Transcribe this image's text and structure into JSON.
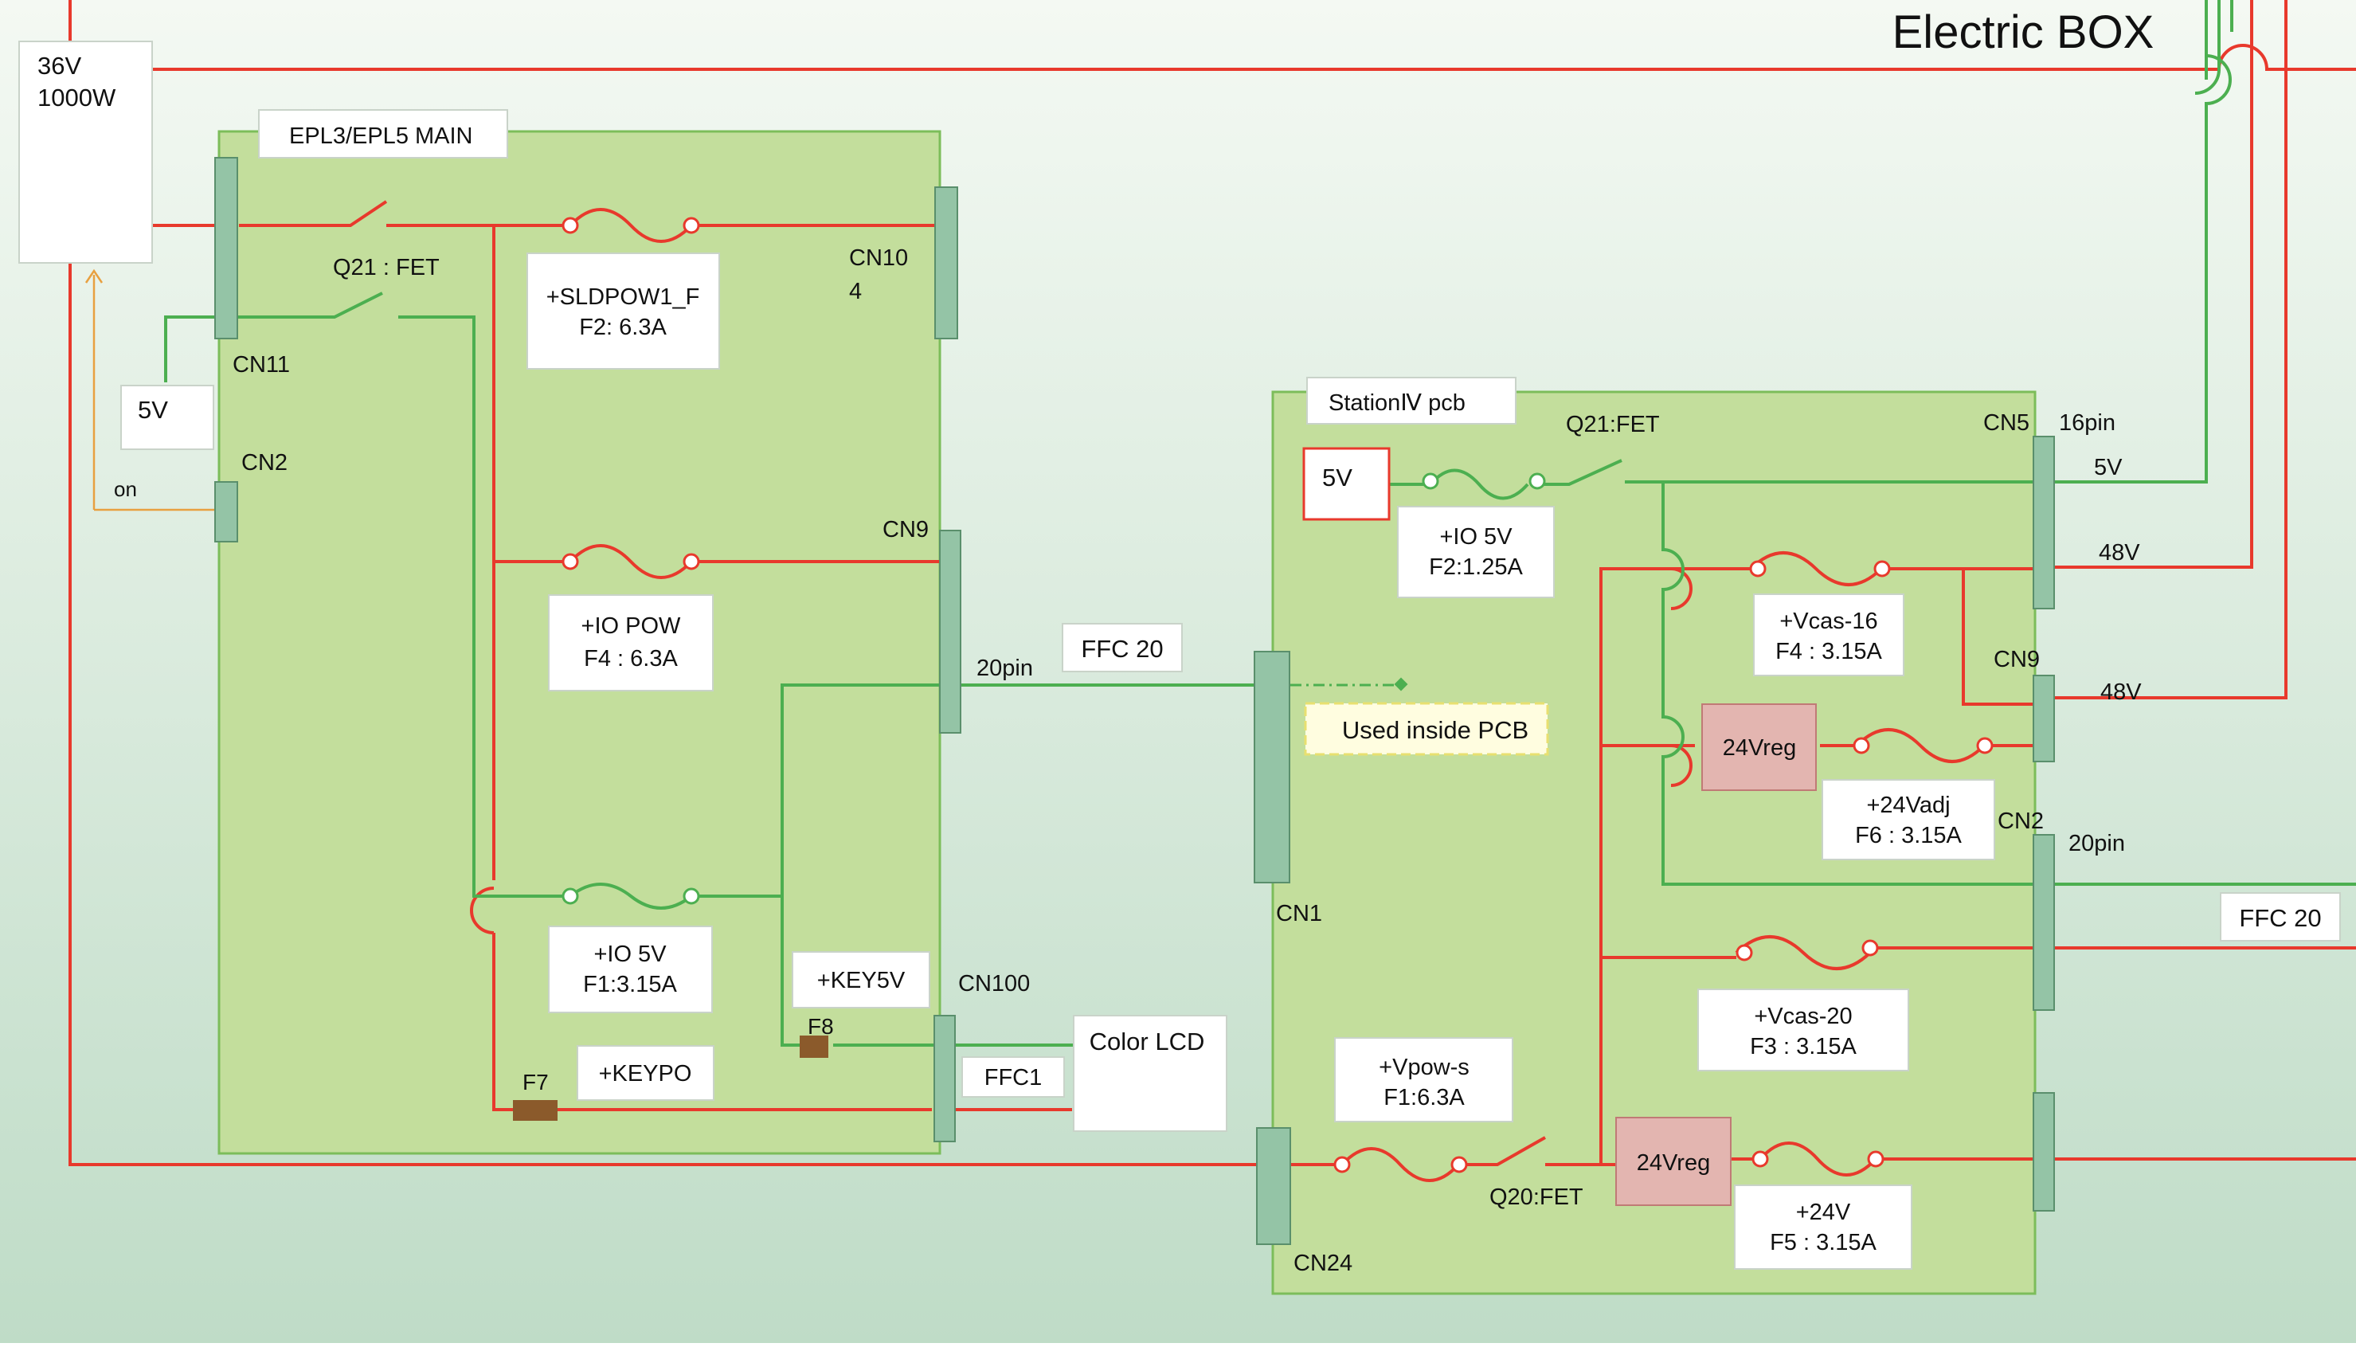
{
  "title": "Electric BOX",
  "psu": {
    "voltage": "36V",
    "power": "1000W"
  },
  "main_board": {
    "label": "EPL3/EPL5 MAIN",
    "switch_label": "Q21 : FET",
    "connectors": {
      "cn11": "CN11",
      "cn2": "CN2",
      "cn104_a": "CN10",
      "cn104_b": "4",
      "cn9": "CN9",
      "cn9_pins": "20pin",
      "cn100": "CN100"
    },
    "on_label": "on",
    "v5_box": "5V",
    "fuses": [
      {
        "line1": "+SLDPOW1_F",
        "line2": "F2:  6.3A"
      },
      {
        "line1": "+IO POW",
        "line2": "F4 :  6.3A"
      },
      {
        "line1": "+IO 5V",
        "line2": "F1:3.15A"
      }
    ],
    "key5v": "+KEY5V",
    "keypo": "+KEYPO",
    "f7": "F7",
    "f8": "F8"
  },
  "links": {
    "ffc20_left": "FFC 20",
    "ffc1": "FFC1",
    "color_lcd": "Color LCD",
    "ffc20_right": "FFC 20"
  },
  "station_board": {
    "label": "StationⅣ   pcb",
    "input_5v": "5V",
    "q21": "Q21:FET",
    "q20": "Q20:FET",
    "connectors": {
      "cn5": "CN5",
      "cn5_pins": "16pin",
      "cn9": "CN9",
      "cn2": "CN2",
      "cn2_pins": "20pin",
      "cn1": "CN1",
      "cn24": "CN24"
    },
    "rail_labels": {
      "v5": "5V",
      "v48_a": "48V",
      "v48_b": "48V"
    },
    "used_inside": "Used inside PCB",
    "regulators": [
      "24Vreg",
      "24Vreg"
    ],
    "fuses": [
      {
        "line1": "+IO 5V",
        "line2": "F2:1.25A"
      },
      {
        "line1": "+Vcas-16",
        "line2": "F4 : 3.15A"
      },
      {
        "line1": "+24Vadj",
        "line2": "F6 : 3.15A"
      },
      {
        "line1": "+Vcas-20",
        "line2": "F3 : 3.15A"
      },
      {
        "line1": "+Vpow-s",
        "line2": "F1:6.3A"
      },
      {
        "line1": "+24V",
        "line2": "F5 : 3.15A"
      }
    ]
  },
  "colors": {
    "power": "#e8392c",
    "signal": "#4caf50",
    "board_fill": "#bfdc96",
    "board_border": "#7cbd5a",
    "connector": "#8fbf9f",
    "regulator": "#e8b4b0",
    "fuse_block": "#8b5a2b",
    "orange_line": "#e8a040"
  }
}
